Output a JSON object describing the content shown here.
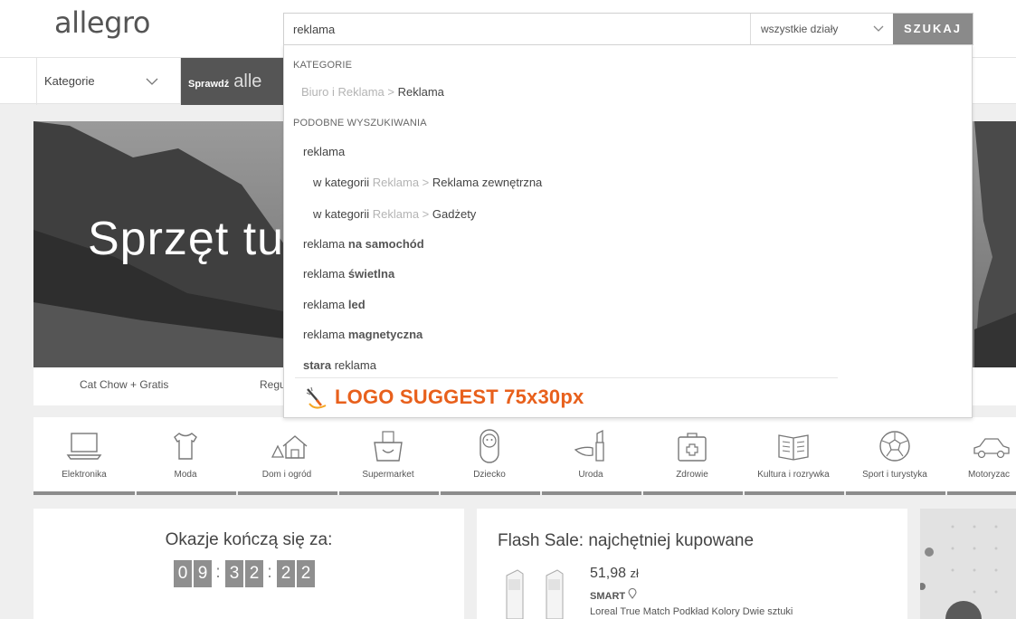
{
  "header": {
    "logo": "allegro",
    "search": {
      "value": "reklama"
    },
    "department": "wszystkie działy",
    "search_button": "SZUKAJ"
  },
  "catbar": {
    "categories_label": "Kategorie",
    "promo_label": "Sprawdź",
    "promo_brand": "alle"
  },
  "hero": {
    "title": "Sprzęt tu",
    "tabs": [
      "Cat Chow + Gratis",
      "Regu"
    ]
  },
  "dropdown": {
    "section_categories": "KATEGORIE",
    "category_path": {
      "parent": "Biuro i Reklama >",
      "child": "Reklama"
    },
    "section_similar": "PODOBNE WYSZUKIWANIA",
    "query": "reklama",
    "in_category_label": "w kategorii",
    "sub1": {
      "parent": "Reklama >",
      "child": "Reklama zewnętrzna"
    },
    "sub2": {
      "parent": "Reklama >",
      "child": "Gadżety"
    },
    "suggestions": [
      {
        "prefix": "reklama",
        "suffix": "na samochód"
      },
      {
        "prefix": "reklama",
        "suffix": "świetlna"
      },
      {
        "prefix": "reklama",
        "suffix": "led"
      },
      {
        "prefix": "reklama",
        "suffix": "magnetyczna"
      },
      {
        "prefix": "stara",
        "suffix": "reklama"
      }
    ],
    "logo_suggest": "LOGO SUGGEST 75x30px",
    "logo_suggest_color": "#e8601c"
  },
  "categories": [
    {
      "label": "Elektronika",
      "icon": "laptop-icon"
    },
    {
      "label": "Moda",
      "icon": "tshirt-icon"
    },
    {
      "label": "Dom i ogród",
      "icon": "house-icon"
    },
    {
      "label": "Supermarket",
      "icon": "basket-icon"
    },
    {
      "label": "Dziecko",
      "icon": "baby-icon"
    },
    {
      "label": "Uroda",
      "icon": "lipstick-icon"
    },
    {
      "label": "Zdrowie",
      "icon": "first-aid-icon"
    },
    {
      "label": "Kultura i rozrywka",
      "icon": "book-icon"
    },
    {
      "label": "Sport i turystyka",
      "icon": "ball-icon"
    },
    {
      "label": "Motoryzac",
      "icon": "car-icon"
    }
  ],
  "deals": {
    "title": "Okazje kończą się za:",
    "digits": [
      "0",
      "9",
      "3",
      "2",
      "2",
      "2"
    ],
    "separator": ":"
  },
  "flash": {
    "title": "Flash Sale: najchętniej kupowane",
    "price_main": "51,98",
    "price_currency": "zł",
    "badge": "SMART",
    "product_name": "Loreal True Match Podkład Kolory Dwie sztuki"
  }
}
